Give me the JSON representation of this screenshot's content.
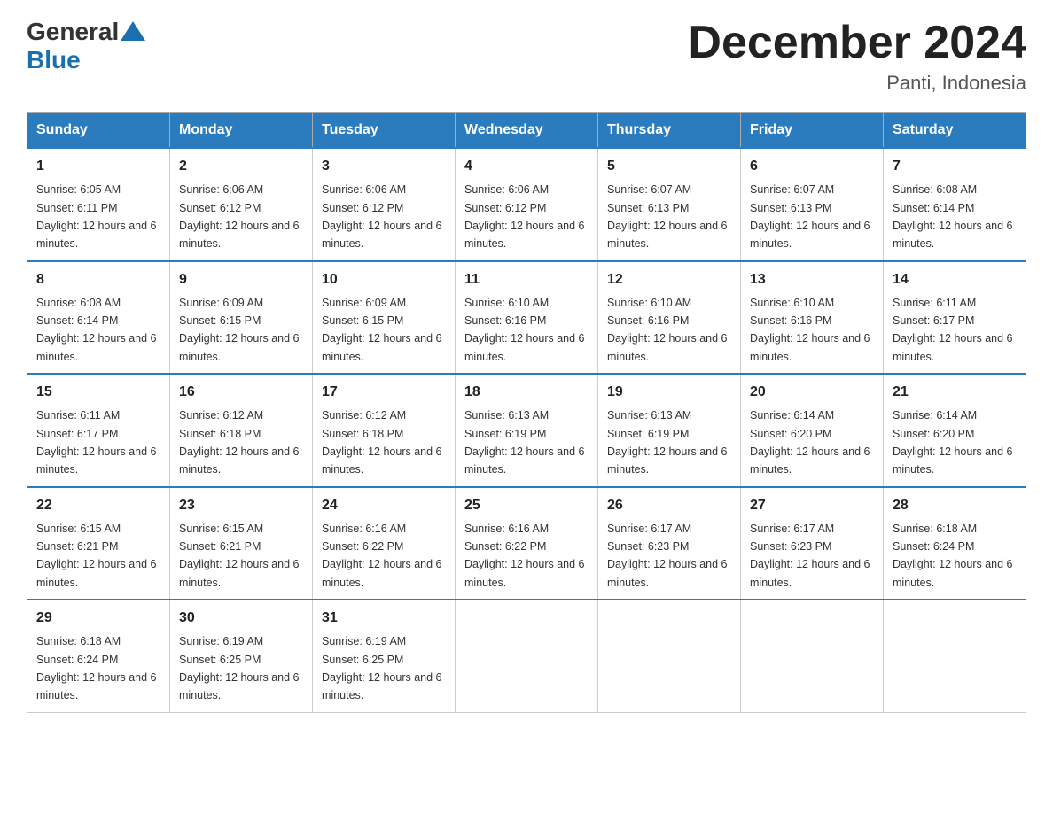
{
  "header": {
    "logo_text_main": "General",
    "logo_text_blue": "Blue",
    "calendar_title": "December 2024",
    "calendar_subtitle": "Panti, Indonesia"
  },
  "days_of_week": [
    "Sunday",
    "Monday",
    "Tuesday",
    "Wednesday",
    "Thursday",
    "Friday",
    "Saturday"
  ],
  "weeks": [
    [
      {
        "day": "1",
        "sunrise": "6:05 AM",
        "sunset": "6:11 PM",
        "daylight": "12 hours and 6 minutes."
      },
      {
        "day": "2",
        "sunrise": "6:06 AM",
        "sunset": "6:12 PM",
        "daylight": "12 hours and 6 minutes."
      },
      {
        "day": "3",
        "sunrise": "6:06 AM",
        "sunset": "6:12 PM",
        "daylight": "12 hours and 6 minutes."
      },
      {
        "day": "4",
        "sunrise": "6:06 AM",
        "sunset": "6:12 PM",
        "daylight": "12 hours and 6 minutes."
      },
      {
        "day": "5",
        "sunrise": "6:07 AM",
        "sunset": "6:13 PM",
        "daylight": "12 hours and 6 minutes."
      },
      {
        "day": "6",
        "sunrise": "6:07 AM",
        "sunset": "6:13 PM",
        "daylight": "12 hours and 6 minutes."
      },
      {
        "day": "7",
        "sunrise": "6:08 AM",
        "sunset": "6:14 PM",
        "daylight": "12 hours and 6 minutes."
      }
    ],
    [
      {
        "day": "8",
        "sunrise": "6:08 AM",
        "sunset": "6:14 PM",
        "daylight": "12 hours and 6 minutes."
      },
      {
        "day": "9",
        "sunrise": "6:09 AM",
        "sunset": "6:15 PM",
        "daylight": "12 hours and 6 minutes."
      },
      {
        "day": "10",
        "sunrise": "6:09 AM",
        "sunset": "6:15 PM",
        "daylight": "12 hours and 6 minutes."
      },
      {
        "day": "11",
        "sunrise": "6:10 AM",
        "sunset": "6:16 PM",
        "daylight": "12 hours and 6 minutes."
      },
      {
        "day": "12",
        "sunrise": "6:10 AM",
        "sunset": "6:16 PM",
        "daylight": "12 hours and 6 minutes."
      },
      {
        "day": "13",
        "sunrise": "6:10 AM",
        "sunset": "6:16 PM",
        "daylight": "12 hours and 6 minutes."
      },
      {
        "day": "14",
        "sunrise": "6:11 AM",
        "sunset": "6:17 PM",
        "daylight": "12 hours and 6 minutes."
      }
    ],
    [
      {
        "day": "15",
        "sunrise": "6:11 AM",
        "sunset": "6:17 PM",
        "daylight": "12 hours and 6 minutes."
      },
      {
        "day": "16",
        "sunrise": "6:12 AM",
        "sunset": "6:18 PM",
        "daylight": "12 hours and 6 minutes."
      },
      {
        "day": "17",
        "sunrise": "6:12 AM",
        "sunset": "6:18 PM",
        "daylight": "12 hours and 6 minutes."
      },
      {
        "day": "18",
        "sunrise": "6:13 AM",
        "sunset": "6:19 PM",
        "daylight": "12 hours and 6 minutes."
      },
      {
        "day": "19",
        "sunrise": "6:13 AM",
        "sunset": "6:19 PM",
        "daylight": "12 hours and 6 minutes."
      },
      {
        "day": "20",
        "sunrise": "6:14 AM",
        "sunset": "6:20 PM",
        "daylight": "12 hours and 6 minutes."
      },
      {
        "day": "21",
        "sunrise": "6:14 AM",
        "sunset": "6:20 PM",
        "daylight": "12 hours and 6 minutes."
      }
    ],
    [
      {
        "day": "22",
        "sunrise": "6:15 AM",
        "sunset": "6:21 PM",
        "daylight": "12 hours and 6 minutes."
      },
      {
        "day": "23",
        "sunrise": "6:15 AM",
        "sunset": "6:21 PM",
        "daylight": "12 hours and 6 minutes."
      },
      {
        "day": "24",
        "sunrise": "6:16 AM",
        "sunset": "6:22 PM",
        "daylight": "12 hours and 6 minutes."
      },
      {
        "day": "25",
        "sunrise": "6:16 AM",
        "sunset": "6:22 PM",
        "daylight": "12 hours and 6 minutes."
      },
      {
        "day": "26",
        "sunrise": "6:17 AM",
        "sunset": "6:23 PM",
        "daylight": "12 hours and 6 minutes."
      },
      {
        "day": "27",
        "sunrise": "6:17 AM",
        "sunset": "6:23 PM",
        "daylight": "12 hours and 6 minutes."
      },
      {
        "day": "28",
        "sunrise": "6:18 AM",
        "sunset": "6:24 PM",
        "daylight": "12 hours and 6 minutes."
      }
    ],
    [
      {
        "day": "29",
        "sunrise": "6:18 AM",
        "sunset": "6:24 PM",
        "daylight": "12 hours and 6 minutes."
      },
      {
        "day": "30",
        "sunrise": "6:19 AM",
        "sunset": "6:25 PM",
        "daylight": "12 hours and 6 minutes."
      },
      {
        "day": "31",
        "sunrise": "6:19 AM",
        "sunset": "6:25 PM",
        "daylight": "12 hours and 6 minutes."
      },
      null,
      null,
      null,
      null
    ]
  ]
}
